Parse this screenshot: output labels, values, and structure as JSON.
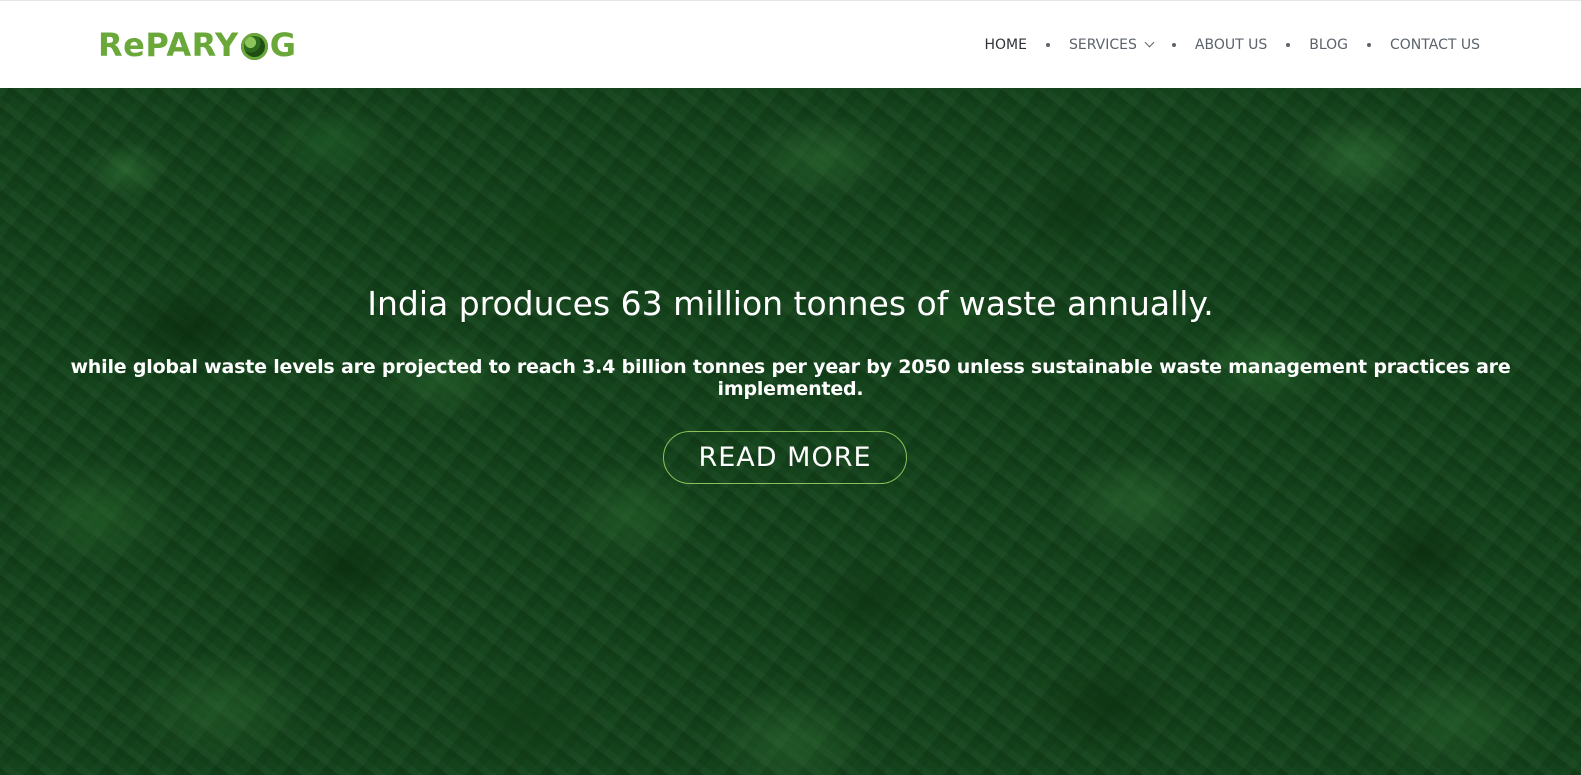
{
  "brand": {
    "logo_prefix": "RePARY",
    "logo_suffix": "G",
    "logo_color": "#6aa83a"
  },
  "nav": {
    "items": [
      {
        "label": "HOME",
        "active": true
      },
      {
        "label": "SERVICES",
        "has_dropdown": true,
        "icon": "chevron-down-icon"
      },
      {
        "label": "ABOUT US"
      },
      {
        "label": "BLOG"
      },
      {
        "label": "CONTACT US"
      }
    ]
  },
  "hero": {
    "title": "India produces 63 million tonnes of waste annually.",
    "subtitle": "while global waste levels are projected to reach 3.4 billion tonnes per year by 2050 unless sustainable waste management practices are implemented.",
    "cta_label": "READ MORE",
    "overlay_color": "#184a1f",
    "cta_border_color": "#8cc05a"
  }
}
